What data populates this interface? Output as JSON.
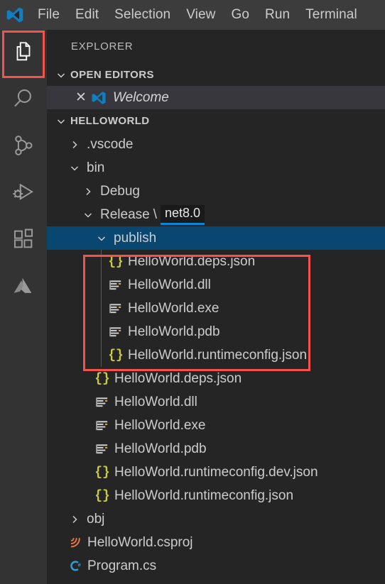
{
  "window": {
    "logo_icon": "vscode-logo-icon",
    "menu_items": [
      "File",
      "Edit",
      "Selection",
      "View",
      "Go",
      "Run",
      "Terminal"
    ]
  },
  "activity_bar": {
    "items": [
      {
        "name": "explorer",
        "icon": "files-icon",
        "active": true
      },
      {
        "name": "search",
        "icon": "search-icon",
        "active": false
      },
      {
        "name": "source-control",
        "icon": "source-control-icon",
        "active": false
      },
      {
        "name": "run-and-debug",
        "icon": "run-debug-icon",
        "active": false
      },
      {
        "name": "extensions",
        "icon": "extensions-icon",
        "active": false
      },
      {
        "name": "azure",
        "icon": "azure-icon",
        "active": false
      }
    ]
  },
  "sidebar": {
    "title": "EXPLORER",
    "open_editors": {
      "label": "OPEN EDITORS",
      "expanded": true,
      "items": [
        {
          "label": "Welcome",
          "icon": "vscode-logo-icon",
          "close_glyph": "✕",
          "italic": true
        }
      ]
    },
    "folder": {
      "label": "HELLOWORLD",
      "expanded": true
    },
    "tree": [
      {
        "label": ".vscode",
        "kind": "folder",
        "expanded": false,
        "depth": 1
      },
      {
        "label": "bin",
        "kind": "folder",
        "expanded": true,
        "depth": 1
      },
      {
        "label": "Debug",
        "kind": "folder",
        "expanded": false,
        "depth": 2
      },
      {
        "label": "Release",
        "kind": "folder",
        "expanded": true,
        "depth": 2,
        "separator": "\\",
        "badge": "net8.0"
      },
      {
        "label": "publish",
        "kind": "folder",
        "expanded": true,
        "depth": 3,
        "selected": true
      },
      {
        "label": "HelloWorld.deps.json",
        "kind": "json",
        "depth": 4,
        "highlighted": true
      },
      {
        "label": "HelloWorld.dll",
        "kind": "binary",
        "depth": 4,
        "highlighted": true
      },
      {
        "label": "HelloWorld.exe",
        "kind": "binary",
        "depth": 4,
        "highlighted": true
      },
      {
        "label": "HelloWorld.pdb",
        "kind": "binary",
        "depth": 4,
        "highlighted": true
      },
      {
        "label": "HelloWorld.runtimeconfig.json",
        "kind": "json",
        "depth": 4,
        "highlighted": true
      },
      {
        "label": "HelloWorld.deps.json",
        "kind": "json",
        "depth": 3
      },
      {
        "label": "HelloWorld.dll",
        "kind": "binary",
        "depth": 3
      },
      {
        "label": "HelloWorld.exe",
        "kind": "binary",
        "depth": 3
      },
      {
        "label": "HelloWorld.pdb",
        "kind": "binary",
        "depth": 3
      },
      {
        "label": "HelloWorld.runtimeconfig.dev.json",
        "kind": "json",
        "depth": 3
      },
      {
        "label": "HelloWorld.runtimeconfig.json",
        "kind": "json",
        "depth": 3
      },
      {
        "label": "obj",
        "kind": "folder",
        "expanded": false,
        "depth": 1
      },
      {
        "label": "HelloWorld.csproj",
        "kind": "csproj",
        "depth": 1
      },
      {
        "label": "Program.cs",
        "kind": "csharp",
        "depth": 1
      }
    ]
  },
  "annotations": [
    {
      "name": "explorer-icon-highlight",
      "color": "#f4524d"
    },
    {
      "name": "publish-files-highlight",
      "color": "#f4524d"
    }
  ],
  "colors": {
    "titlebar_bg": "#3c3c3c",
    "activitybar_bg": "#333333",
    "sidebar_bg": "#252526",
    "selection_bg": "#094771",
    "open_editor_bg": "#37373d",
    "text": "#cccccc",
    "json_icon": "#cbcb41",
    "csproj_icon": "#e8733f",
    "csharp_icon": "#2f9fd6",
    "annotation": "#f4524d",
    "badge_underline": "#0a84d8"
  }
}
